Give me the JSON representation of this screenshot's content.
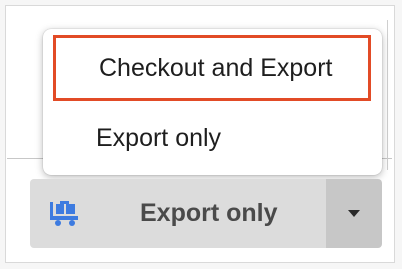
{
  "dropdown": {
    "items": [
      {
        "label": "Checkout and Export",
        "highlighted": true
      },
      {
        "label": "Export only",
        "highlighted": false
      }
    ],
    "highlight_color": "#e24b26"
  },
  "split_button": {
    "label": "Export only",
    "icon": "cart-icon",
    "toggle_icon": "chevron-down-icon",
    "icon_color": "#3d7be0"
  }
}
